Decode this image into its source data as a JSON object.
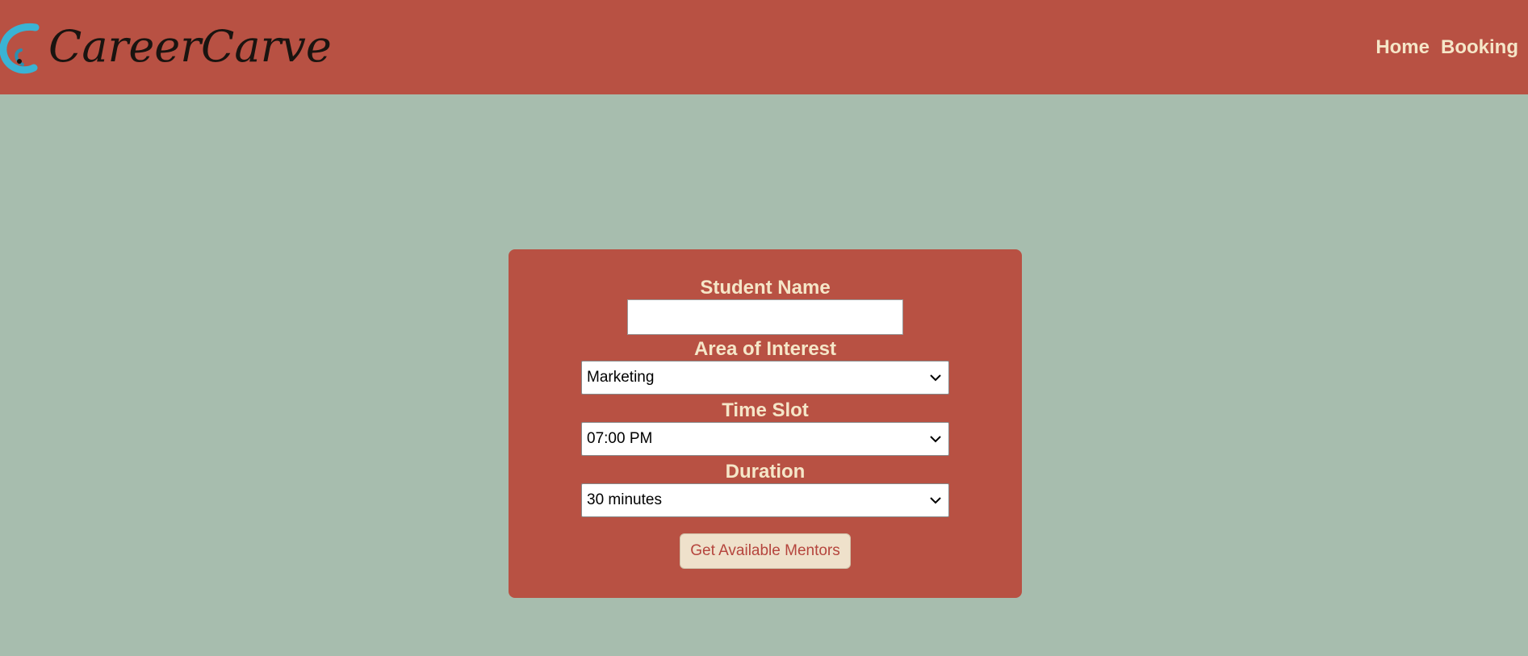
{
  "header": {
    "brand": "CareerCarve",
    "nav": [
      {
        "label": "Home"
      },
      {
        "label": "Booking"
      }
    ],
    "background": "#b85143"
  },
  "form": {
    "student_name": {
      "label": "Student Name",
      "value": ""
    },
    "area_of_interest": {
      "label": "Area of Interest",
      "selected": "Marketing"
    },
    "time_slot": {
      "label": "Time Slot",
      "selected": "07:00 PM"
    },
    "duration": {
      "label": "Duration",
      "selected": "30 minutes"
    },
    "submit_label": "Get Available Mentors"
  },
  "colors": {
    "page_background": "#a7bdae",
    "accent": "#b85143",
    "label_text": "#f5e6c8",
    "button_bg": "#efe1cb",
    "button_text": "#b5453d"
  },
  "icons": {
    "logo": "careercarve-swirl-logo-icon",
    "select_arrow": "chevron-down-icon"
  }
}
